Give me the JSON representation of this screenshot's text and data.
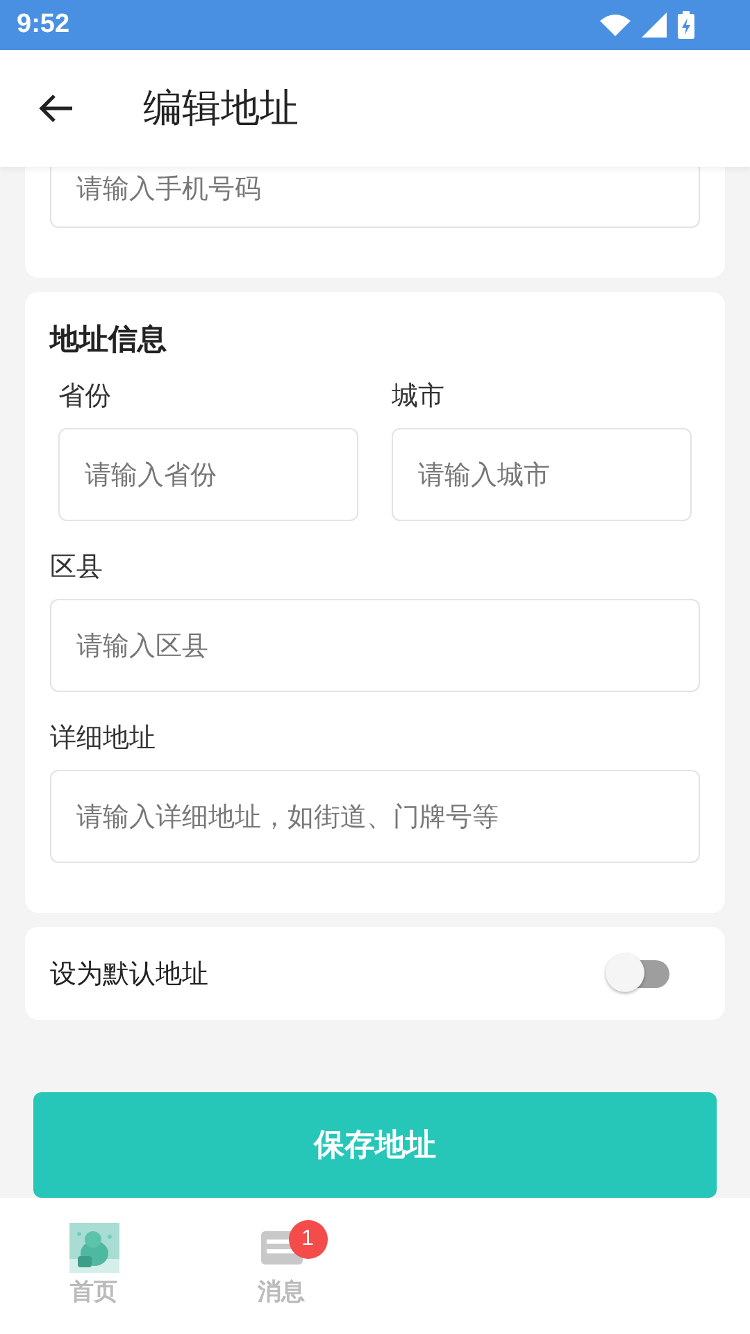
{
  "status_bar": {
    "time": "9:52"
  },
  "header": {
    "title": "编辑地址"
  },
  "phone_field": {
    "placeholder": "请输入手机号码"
  },
  "address": {
    "title": "地址信息",
    "fields": [
      {
        "kind": "half",
        "label": "省份",
        "placeholder": "请输入省份"
      },
      {
        "kind": "half",
        "label": "城市",
        "placeholder": "请输入城市"
      },
      {
        "kind": "full",
        "label": "区县",
        "placeholder": "请输入区县"
      },
      {
        "kind": "full",
        "label": "详细地址",
        "placeholder": "请输入详细地址，如街道、门牌号等"
      }
    ]
  },
  "default_toggle": {
    "label": "设为默认地址",
    "on": false
  },
  "save_button": {
    "label": "保存地址"
  },
  "nav": {
    "items": [
      {
        "kind": "picture",
        "label": "首页"
      },
      {
        "kind": "message",
        "label": "消息",
        "badge": "1"
      }
    ]
  }
}
